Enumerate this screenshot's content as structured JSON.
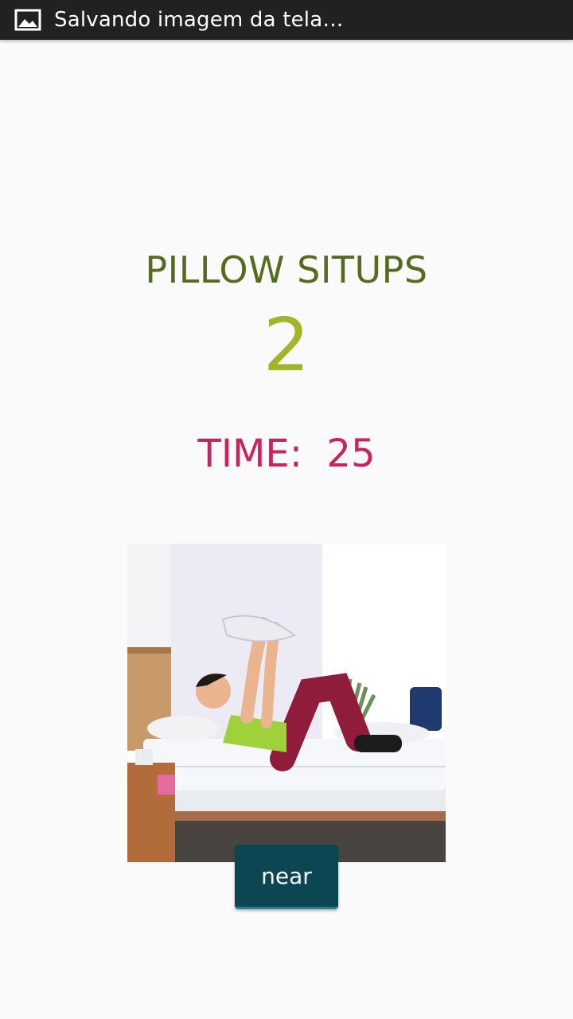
{
  "status_bar": {
    "icon": "image-icon",
    "text": "Salvando imagem da tela…"
  },
  "exercise": {
    "title": "PILLOW SITUPS",
    "rep_count": "2",
    "timer_text": "TIME:  25"
  },
  "near_button": {
    "label": "near"
  },
  "colors": {
    "status_bar_bg": "#212121",
    "title": "#556b1e",
    "count": "#a3b526",
    "timer": "#c8235e",
    "button_bg": "#0b4652"
  }
}
